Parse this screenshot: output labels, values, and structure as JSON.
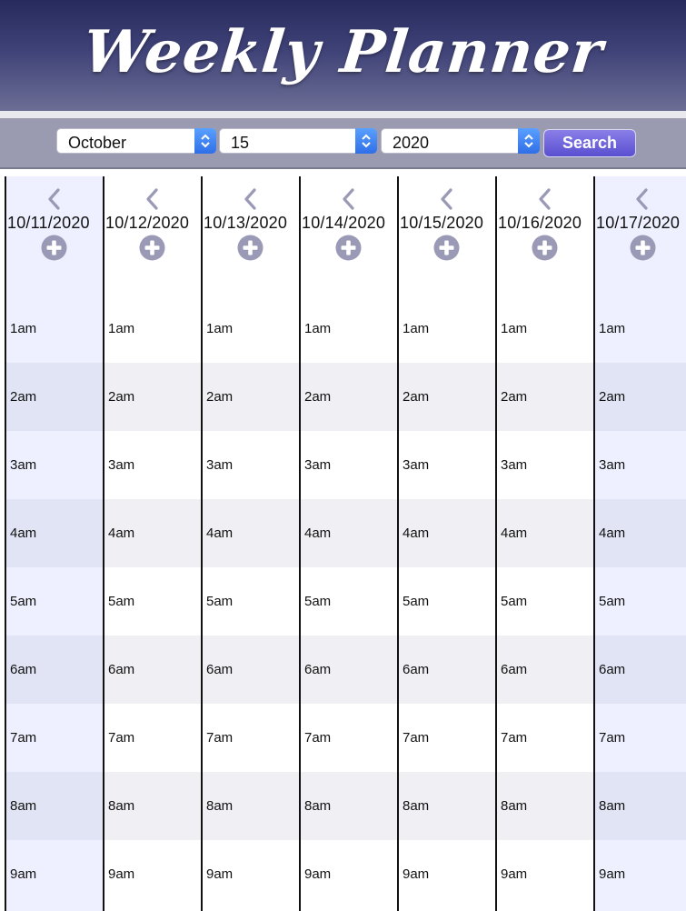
{
  "app": {
    "title": "Weekly Planner"
  },
  "toolbar": {
    "month": {
      "value": "October"
    },
    "day": {
      "value": "15"
    },
    "year": {
      "value": "2020"
    },
    "search_label": "Search"
  },
  "days": [
    {
      "date": "10/11/2020",
      "weekend": true
    },
    {
      "date": "10/12/2020",
      "weekend": false
    },
    {
      "date": "10/13/2020",
      "weekend": false
    },
    {
      "date": "10/14/2020",
      "weekend": false
    },
    {
      "date": "10/15/2020",
      "weekend": false
    },
    {
      "date": "10/16/2020",
      "weekend": false
    },
    {
      "date": "10/17/2020",
      "weekend": true
    }
  ],
  "hours": [
    "1am",
    "2am",
    "3am",
    "4am",
    "5am",
    "6am",
    "7am",
    "8am",
    "9am"
  ],
  "icons": {
    "nav": "chevron-left-icon",
    "add": "plus-circle-icon",
    "select": "select-updown-icon"
  },
  "colors": {
    "header_top": "#262a5c",
    "header_bottom": "#6c6e95",
    "toolbar": "#9a9ab0",
    "search_button": "#6a5fd8",
    "select_arrow": "#3a7ff0",
    "icon_gray": "#9a9ab6",
    "weekend_column": "#eef0ff"
  }
}
